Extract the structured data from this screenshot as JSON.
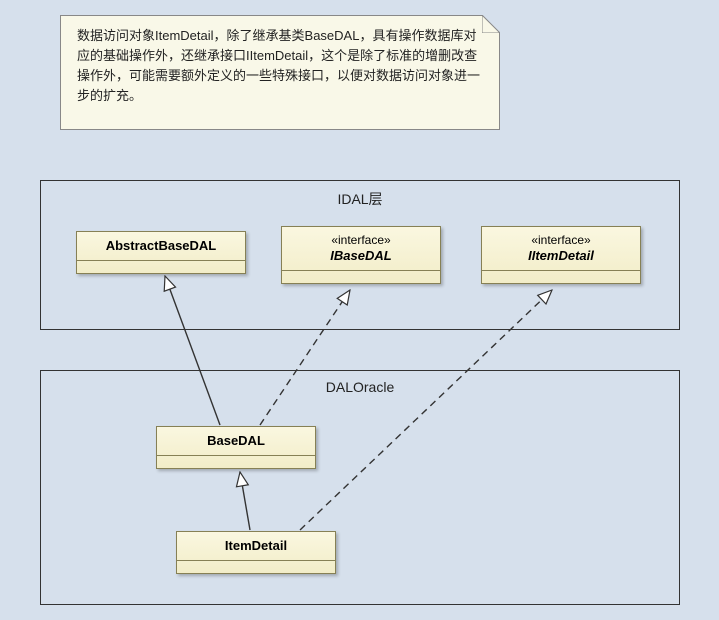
{
  "diagram": {
    "note_text": "数据访问对象ItemDetail，除了继承基类BaseDAL，具有操作数据库对应的基础操作外，还继承接口IItemDetail，这个是除了标准的增删改查操作外，可能需要额外定义的一些特殊接口，以便对数据访问对象进一步的扩充。",
    "packages": {
      "idal": {
        "title": "IDAL层"
      },
      "daloracle": {
        "title": "DALOracle"
      }
    },
    "classes": {
      "abstractBaseDAL": {
        "stereotype": "",
        "name": "AbstractBaseDAL",
        "italic": false
      },
      "ibaseDAL": {
        "stereotype": "«interface»",
        "name": "IBaseDAL",
        "italic": true
      },
      "iitemDetail": {
        "stereotype": "«interface»",
        "name": "IItemDetail",
        "italic": true
      },
      "baseDAL": {
        "stereotype": "",
        "name": "BaseDAL",
        "italic": false
      },
      "itemDetail": {
        "stereotype": "",
        "name": "ItemDetail",
        "italic": false
      }
    },
    "relationships": [
      {
        "from": "baseDAL",
        "to": "abstractBaseDAL",
        "type": "generalization"
      },
      {
        "from": "baseDAL",
        "to": "ibaseDAL",
        "type": "realization"
      },
      {
        "from": "itemDetail",
        "to": "baseDAL",
        "type": "generalization"
      },
      {
        "from": "itemDetail",
        "to": "iitemDetail",
        "type": "realization"
      }
    ]
  }
}
